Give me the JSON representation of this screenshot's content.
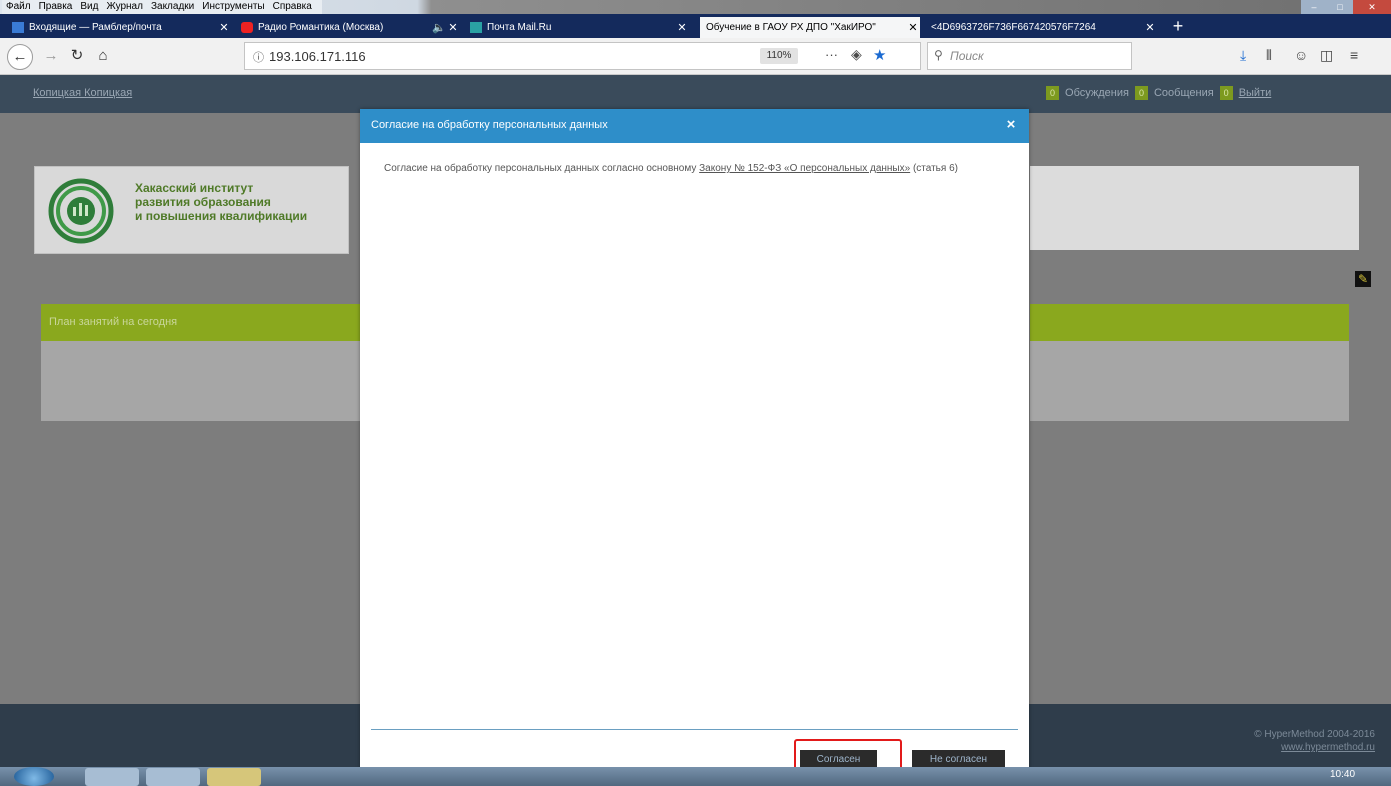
{
  "menubar": {
    "items": [
      "Файл",
      "Правка",
      "Вид",
      "Журнал",
      "Закладки",
      "Инструменты",
      "Справка"
    ]
  },
  "tabs": [
    {
      "label": "Входящие — Рамблер/почта",
      "active": false
    },
    {
      "label": "Радио Романтика (Москва)",
      "active": false
    },
    {
      "label": "Почта Mail.Ru",
      "active": false
    },
    {
      "label": "Обучение в ГАОУ РХ ДПО \"ХакИРО\"",
      "active": true
    },
    {
      "label": "<4D6963726F736F667420576F7264",
      "active": false
    }
  ],
  "nav": {
    "url": "193.106.171.116",
    "zoom": "110%",
    "search_placeholder": "Поиск"
  },
  "site": {
    "username": "Копицкая Копицкая",
    "right_nav": [
      {
        "badge": "0"
      },
      {
        "label": "Обсуждения",
        "badge": "0"
      },
      {
        "label": "Сообщения",
        "badge": "0"
      },
      {
        "label": "Выйти"
      }
    ],
    "logo_text": [
      "Хакасский институт",
      "развития образования",
      "и повышения квалификации"
    ],
    "green_label": "План занятий на сегодня",
    "copyright": "© HyperMethod 2004-2016",
    "copyright_link": "www.hypermethod.ru"
  },
  "modal": {
    "title": "Согласие на обработку персональных данных",
    "close": "×",
    "body_prefix": "Согласие на обработку персональных данных согласно основному ",
    "body_link": "Закону № 152-ФЗ «О персональных данных»",
    "body_suffix": " (статья 6)",
    "agree": "Согласен",
    "disagree": "Не согласен"
  },
  "taskbar": {
    "clock": "10:40"
  },
  "colors": {
    "tab_strip": "#142a5c",
    "modal_header": "#2e8ec9",
    "accent_green": "#8aa81e",
    "highlight": "#e21a1a"
  }
}
